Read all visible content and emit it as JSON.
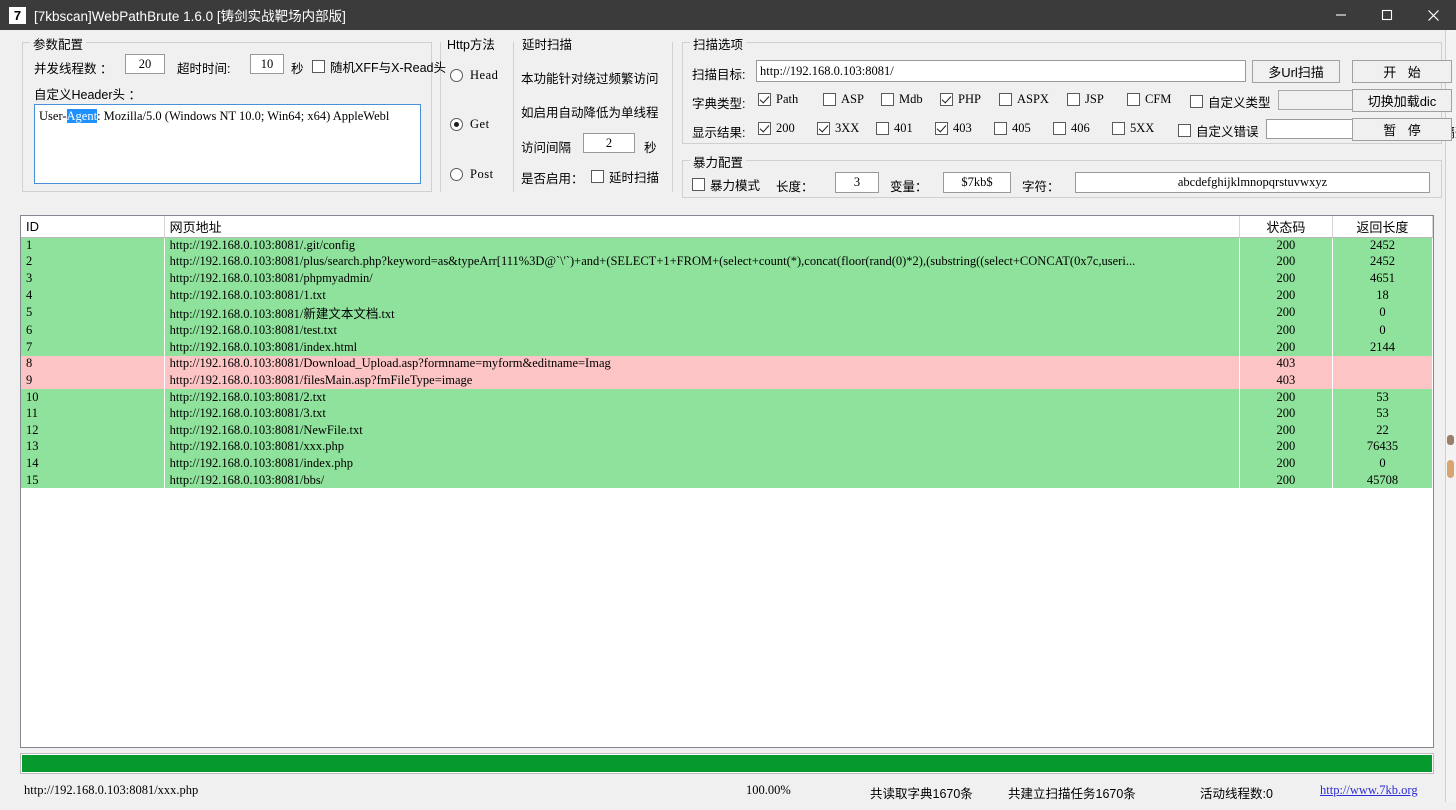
{
  "window": {
    "icon_text": "7",
    "title": "[7kbscan]WebPathBrute 1.6.0 [铸剑实战靶场内部版]",
    "minimize_label": "Minimize",
    "maximize_label": "Maximize",
    "close_label": "Close"
  },
  "params": {
    "group_title": "参数配置",
    "threads_label": "并发线程数 ：",
    "threads_value": "20",
    "timeout_label": "超时时间:",
    "timeout_value": "10",
    "seconds_label": "秒",
    "random_xff_label": "随机XFF与X-Read头",
    "random_xff_checked": false,
    "header_label": "自定义Header头 ：",
    "header_prefix": "User-",
    "header_selected": "Agent",
    "header_rest": ": Mozilla/5.0 (Windows NT 10.0; Win64; x64) AppleWebl"
  },
  "http_method": {
    "group_title": "Http方法",
    "options": [
      {
        "label": "Head",
        "selected": false
      },
      {
        "label": "Get",
        "selected": true
      },
      {
        "label": "Post",
        "selected": false
      }
    ]
  },
  "delay_scan": {
    "group_title": "延时扫描",
    "desc_line1": "本功能针对绕过频繁访问",
    "desc_line2": "如启用自动降低为单线程",
    "interval_label": "访问间隔",
    "interval_value": "2",
    "seconds_label": "秒",
    "enable_label": "是否启用：",
    "enable_checkbox_label": "延时扫描",
    "enable_checked": false
  },
  "scan_options": {
    "group_title": "扫描选项",
    "target_label": "扫描目标:",
    "target_value": "http://192.168.0.103:8081/",
    "multi_url_button": "多Url扫描",
    "start_button": "开 始",
    "dict_type_label": "字典类型:",
    "dict_types": [
      {
        "label": "Path",
        "checked": true
      },
      {
        "label": "ASP",
        "checked": false
      },
      {
        "label": "Mdb",
        "checked": false
      },
      {
        "label": "PHP",
        "checked": true
      },
      {
        "label": "ASPX",
        "checked": false
      },
      {
        "label": "JSP",
        "checked": false
      },
      {
        "label": "CFM",
        "checked": false
      }
    ],
    "custom_type_label": "自定义类型",
    "custom_type_checked": false,
    "custom_type_value": "",
    "switch_dic_button": "切换加载dic",
    "show_result_label": "显示结果:",
    "result_codes": [
      {
        "label": "200",
        "checked": true
      },
      {
        "label": "3XX",
        "checked": true
      },
      {
        "label": "401",
        "checked": false
      },
      {
        "label": "403",
        "checked": true
      },
      {
        "label": "405",
        "checked": false
      },
      {
        "label": "406",
        "checked": false
      },
      {
        "label": "5XX",
        "checked": false
      }
    ],
    "custom_error_label": "自定义错误",
    "custom_error_checked": false,
    "custom_error_value": "",
    "separator_hint": "多个词用 | 隔开",
    "pause_button": "暂 停"
  },
  "brute_config": {
    "group_title": "暴力配置",
    "mode_label": "暴力模式",
    "mode_checked": false,
    "length_label": "长度：",
    "length_value": "3",
    "variable_label": "变量：",
    "variable_value": "$7kb$",
    "charset_label": "字符：",
    "charset_value": "abcdefghijklmnopqrstuvwxyz"
  },
  "results": {
    "columns": [
      "ID",
      "网页地址",
      "状态码",
      "返回长度"
    ],
    "rows": [
      {
        "id": "1",
        "url": "http://192.168.0.103:8081/.git/config",
        "code": "200",
        "len": "2452",
        "status": "ok"
      },
      {
        "id": "2",
        "url": "http://192.168.0.103:8081/plus/search.php?keyword=as&typeArr[111%3D@`\\'`)+and+(SELECT+1+FROM+(select+count(*),concat(floor(rand(0)*2),(substring((select+CONCAT(0x7c,useri...",
        "code": "200",
        "len": "2452",
        "status": "ok"
      },
      {
        "id": "3",
        "url": "http://192.168.0.103:8081/phpmyadmin/",
        "code": "200",
        "len": "4651",
        "status": "ok"
      },
      {
        "id": "4",
        "url": "http://192.168.0.103:8081/1.txt",
        "code": "200",
        "len": "18",
        "status": "ok"
      },
      {
        "id": "5",
        "url": "http://192.168.0.103:8081/新建文本文档.txt",
        "code": "200",
        "len": "0",
        "status": "ok"
      },
      {
        "id": "6",
        "url": "http://192.168.0.103:8081/test.txt",
        "code": "200",
        "len": "0",
        "status": "ok"
      },
      {
        "id": "7",
        "url": "http://192.168.0.103:8081/index.html",
        "code": "200",
        "len": "2144",
        "status": "ok"
      },
      {
        "id": "8",
        "url": "http://192.168.0.103:8081/Download_Upload.asp?formname=myform&editname=Imag",
        "code": "403",
        "len": "",
        "status": "err"
      },
      {
        "id": "9",
        "url": "http://192.168.0.103:8081/filesMain.asp?fmFileType=image",
        "code": "403",
        "len": "",
        "status": "err"
      },
      {
        "id": "10",
        "url": "http://192.168.0.103:8081/2.txt",
        "code": "200",
        "len": "53",
        "status": "ok"
      },
      {
        "id": "11",
        "url": "http://192.168.0.103:8081/3.txt",
        "code": "200",
        "len": "53",
        "status": "ok"
      },
      {
        "id": "12",
        "url": "http://192.168.0.103:8081/NewFile.txt",
        "code": "200",
        "len": "22",
        "status": "ok"
      },
      {
        "id": "13",
        "url": "http://192.168.0.103:8081/xxx.php",
        "code": "200",
        "len": "76435",
        "status": "ok"
      },
      {
        "id": "14",
        "url": "http://192.168.0.103:8081/index.php",
        "code": "200",
        "len": "0",
        "status": "ok"
      },
      {
        "id": "15",
        "url": "http://192.168.0.103:8081/bbs/",
        "code": "200",
        "len": "45708",
        "status": "ok"
      }
    ]
  },
  "progress": {
    "percent": 100,
    "percent_text": "100.00%",
    "fill_color": "#069a2e"
  },
  "status": {
    "current_url": "http://192.168.0.103:8081/xxx.php",
    "dict_count": "共读取字典1670条",
    "task_count": "共建立扫描任务1670条",
    "active_threads": "活动线程数:0",
    "site_link": "http://www.7kb.org"
  }
}
